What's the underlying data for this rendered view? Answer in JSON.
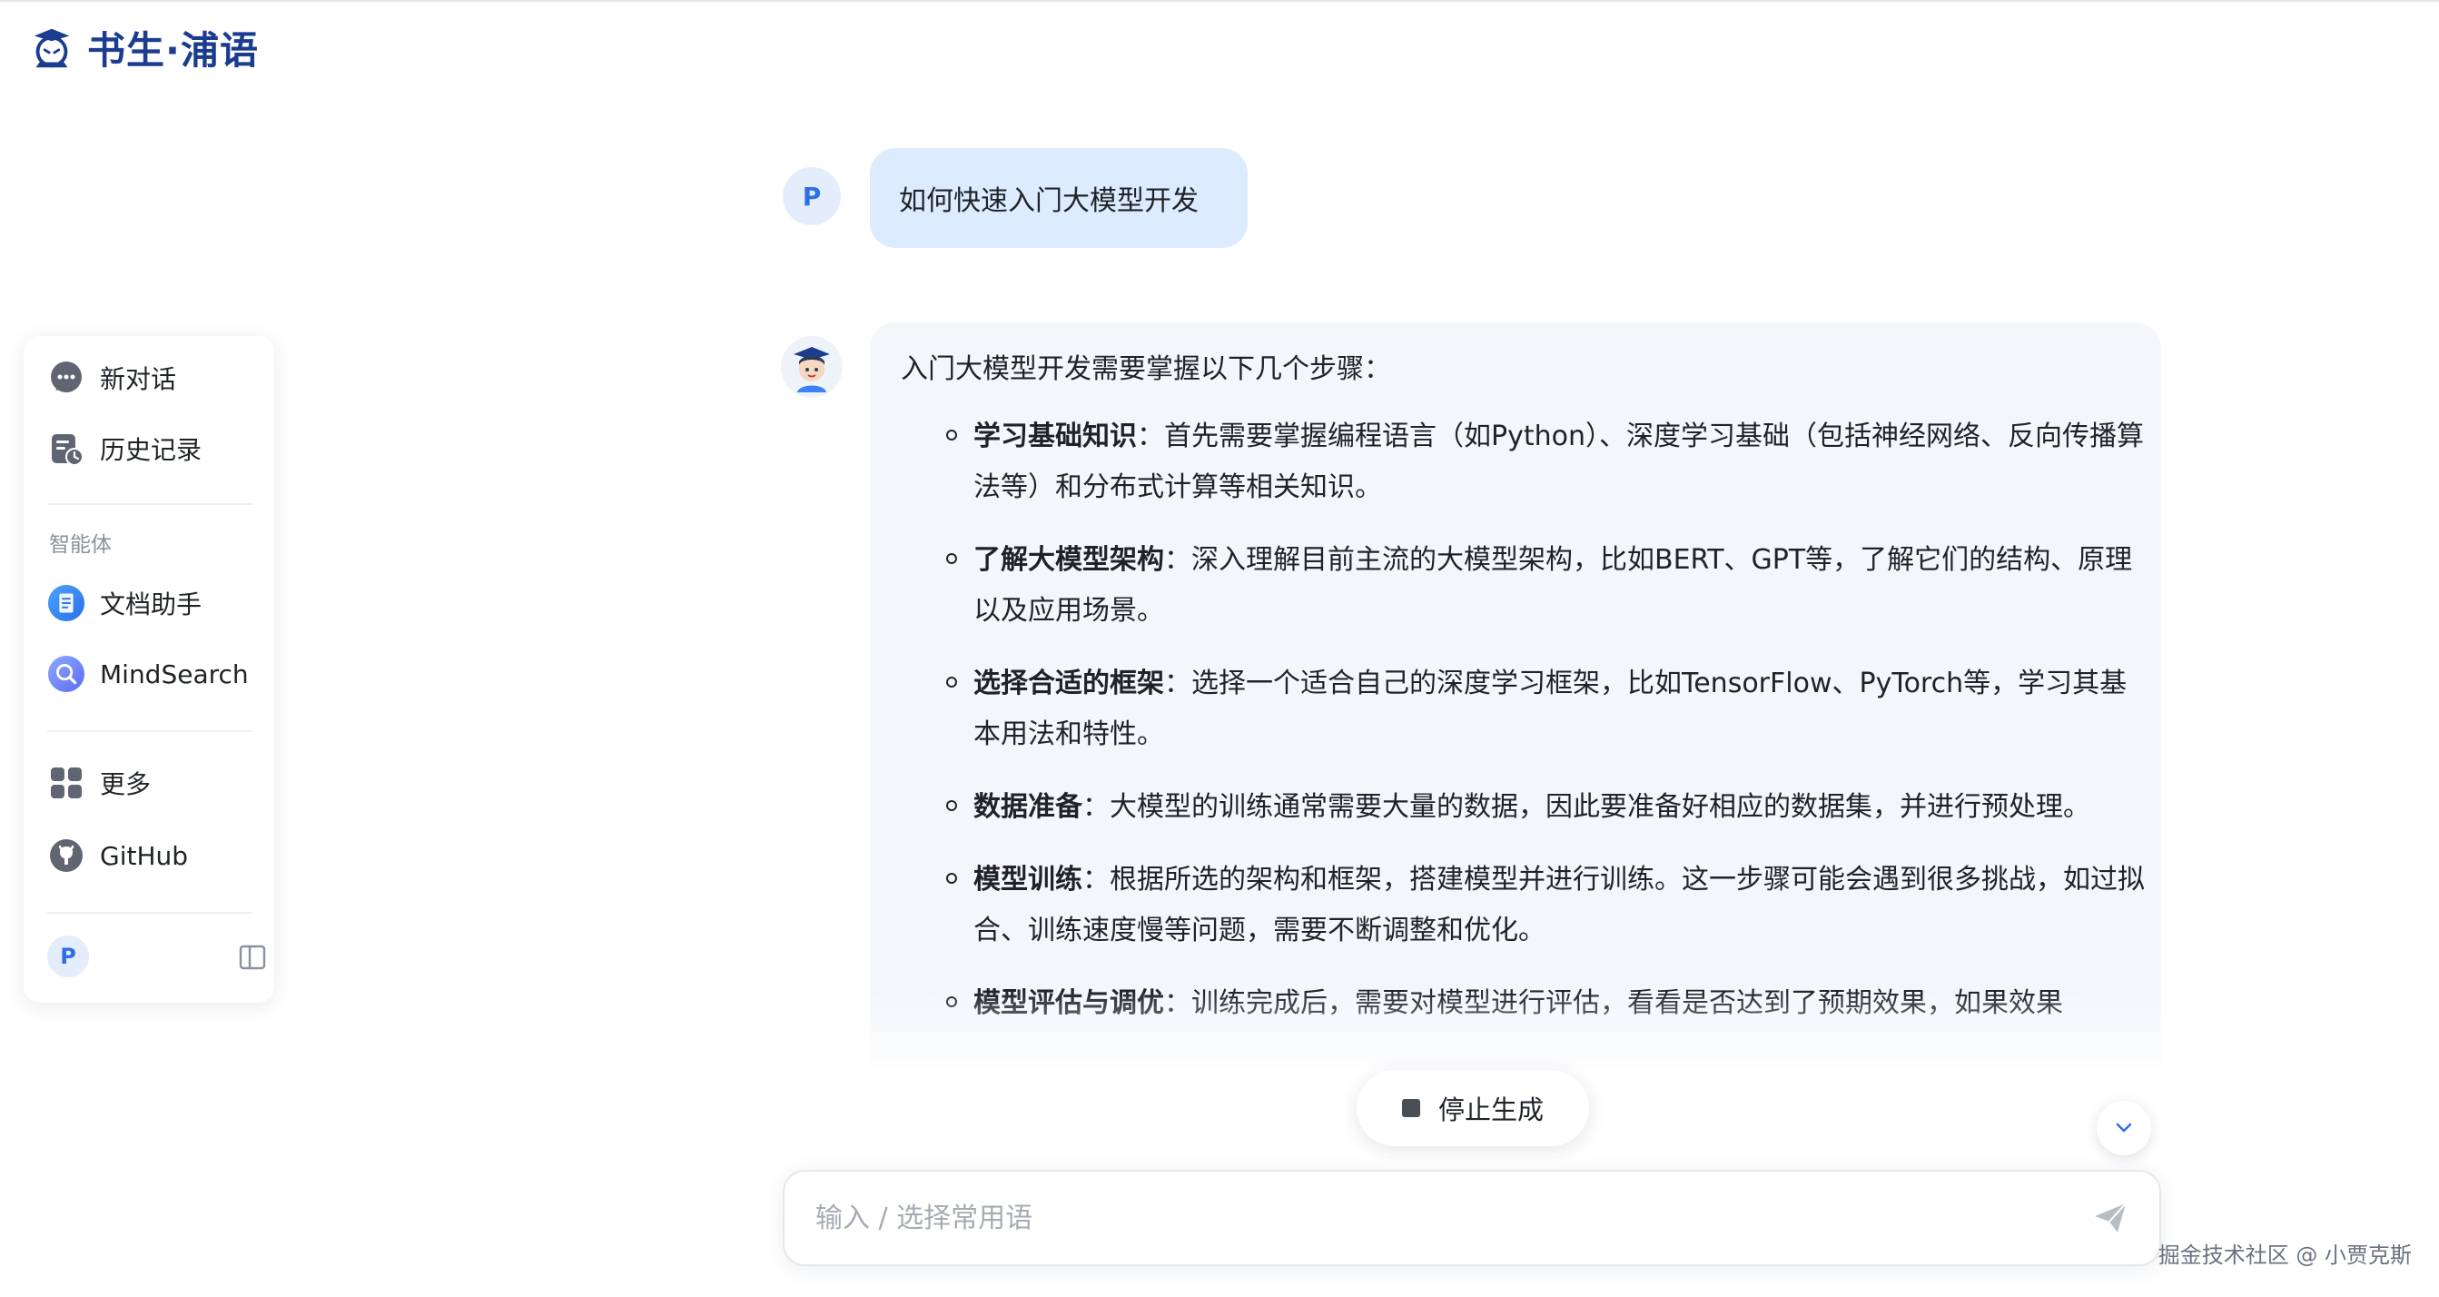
{
  "app": {
    "logo_text": "书生·浦语"
  },
  "sidebar": {
    "items": [
      {
        "label": "新对话",
        "icon": "chat-bubble-icon"
      },
      {
        "label": "历史记录",
        "icon": "history-icon"
      }
    ],
    "agents_title": "智能体",
    "agents": [
      {
        "label": "文档助手",
        "icon": "document-assistant-icon"
      },
      {
        "label": "MindSearch",
        "icon": "mindsearch-icon"
      }
    ],
    "more": [
      {
        "label": "更多",
        "icon": "grid-icon"
      },
      {
        "label": "GitHub",
        "icon": "github-icon"
      }
    ],
    "user_initial": "P"
  },
  "chat": {
    "user_initial": "P",
    "user_message": "如何快速入门大模型开发",
    "bot_intro": "入门大模型开发需要掌握以下几个步骤：",
    "steps": [
      {
        "title": "学习基础知识",
        "text": "：首先需要掌握编程语言（如Python）、深度学习基础（包括神经网络、反向传播算法等）和分布式计算等相关知识。"
      },
      {
        "title": "了解大模型架构",
        "text": "：深入理解目前主流的大模型架构，比如BERT、GPT等，了解它们的结构、原理以及应用场景。"
      },
      {
        "title": "选择合适的框架",
        "text": "：选择一个适合自己的深度学习框架，比如TensorFlow、PyTorch等，学习其基本用法和特性。"
      },
      {
        "title": "数据准备",
        "text": "：大模型的训练通常需要大量的数据，因此要准备好相应的数据集，并进行预处理。"
      },
      {
        "title": "模型训练",
        "text": "：根据所选的架构和框架，搭建模型并进行训练。这一步骤可能会遇到很多挑战，如过拟合、训练速度慢等问题，需要不断调整和优化。"
      },
      {
        "title": "模型评估与调优",
        "text": "：训练完成后，需要对模型进行评估，看看是否达到了预期效果，如果效果"
      }
    ]
  },
  "controls": {
    "stop_label": "停止生成",
    "input_placeholder": "输入 / 选择常用语"
  },
  "watermark": "掘金技术社区 @ 小贾克斯",
  "colors": {
    "accent": "#2f6fe4",
    "user_bubble": "#dcebfd",
    "bot_bubble": "#f4f6fa"
  }
}
